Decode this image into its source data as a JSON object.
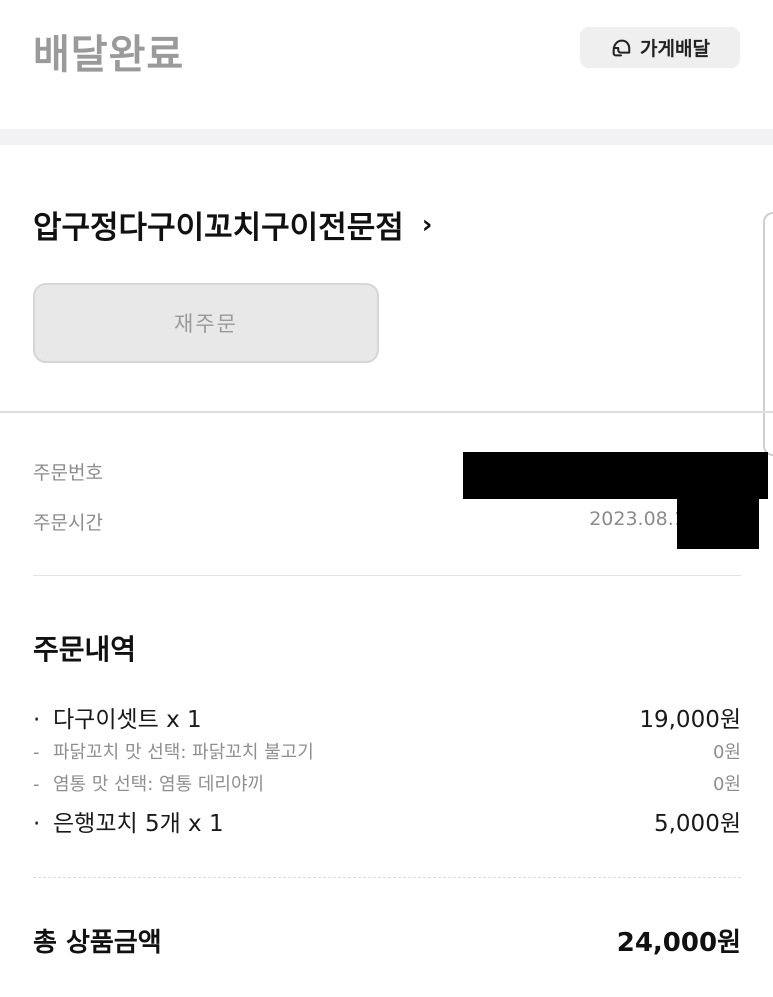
{
  "header": {
    "status": "배달완료",
    "delivery_chip": {
      "icon": "helmet-icon",
      "label": "가게배달"
    }
  },
  "store": {
    "name": "압구정다구이꼬치구이전문점",
    "chevron": "›"
  },
  "reorder_label": "재주문",
  "order_info": {
    "number_label": "주문번호",
    "time_label": "주문시간",
    "time_value": "2023.08.19"
  },
  "order_details": {
    "title": "주문내역",
    "rows": [
      {
        "bullet": "·",
        "name": "다구이셋트 x 1",
        "price": "19,000원"
      },
      {
        "bullet": "-",
        "name": "파닭꼬치 맛 선택: 파닭꼬치 불고기",
        "price": "0원"
      },
      {
        "bullet": "-",
        "name": "염통 맛 선택: 염통 데리야끼",
        "price": "0원"
      },
      {
        "bullet": "·",
        "name": "은행꼬치 5개 x 1",
        "price": "5,000원"
      }
    ]
  },
  "total": {
    "label": "총 상품금액",
    "value": "24,000원"
  }
}
